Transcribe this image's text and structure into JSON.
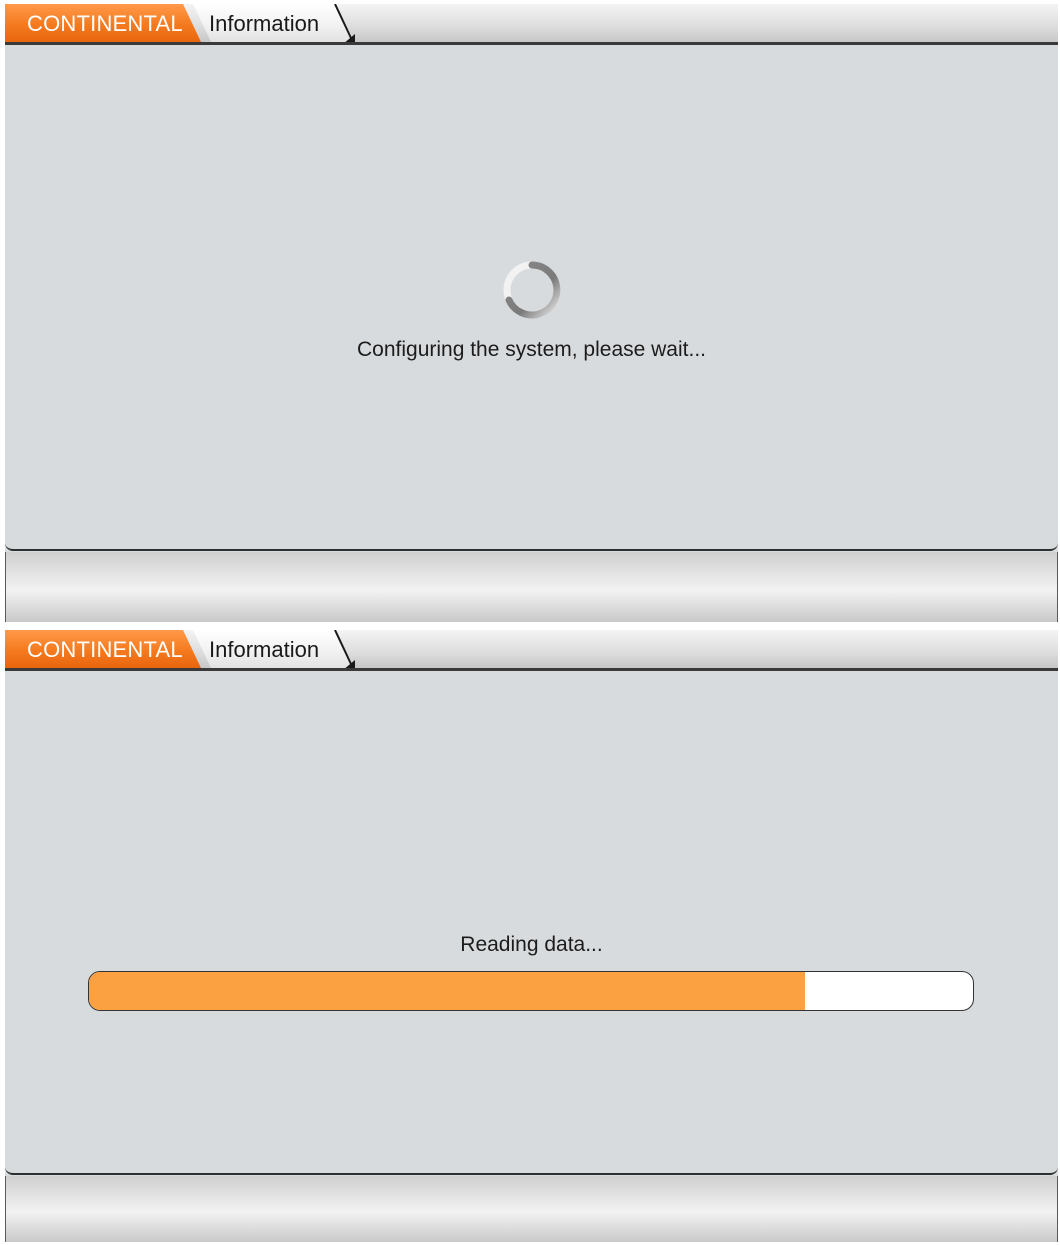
{
  "screens": [
    {
      "tabs": {
        "brand": "CONTINENTAL",
        "section": "Information"
      },
      "status_message": "Configuring the system,  please wait...",
      "indicator": "loading-spinner"
    },
    {
      "tabs": {
        "brand": "CONTINENTAL",
        "section": "Information"
      },
      "status_message": "Reading data...",
      "progress": {
        "fraction": 0.81
      }
    }
  ],
  "colors": {
    "brand_tab": "#f57a1e",
    "progress_fill": "#fca141",
    "progress_track": "#ffffff",
    "panel_background": "#d8dbdd"
  }
}
